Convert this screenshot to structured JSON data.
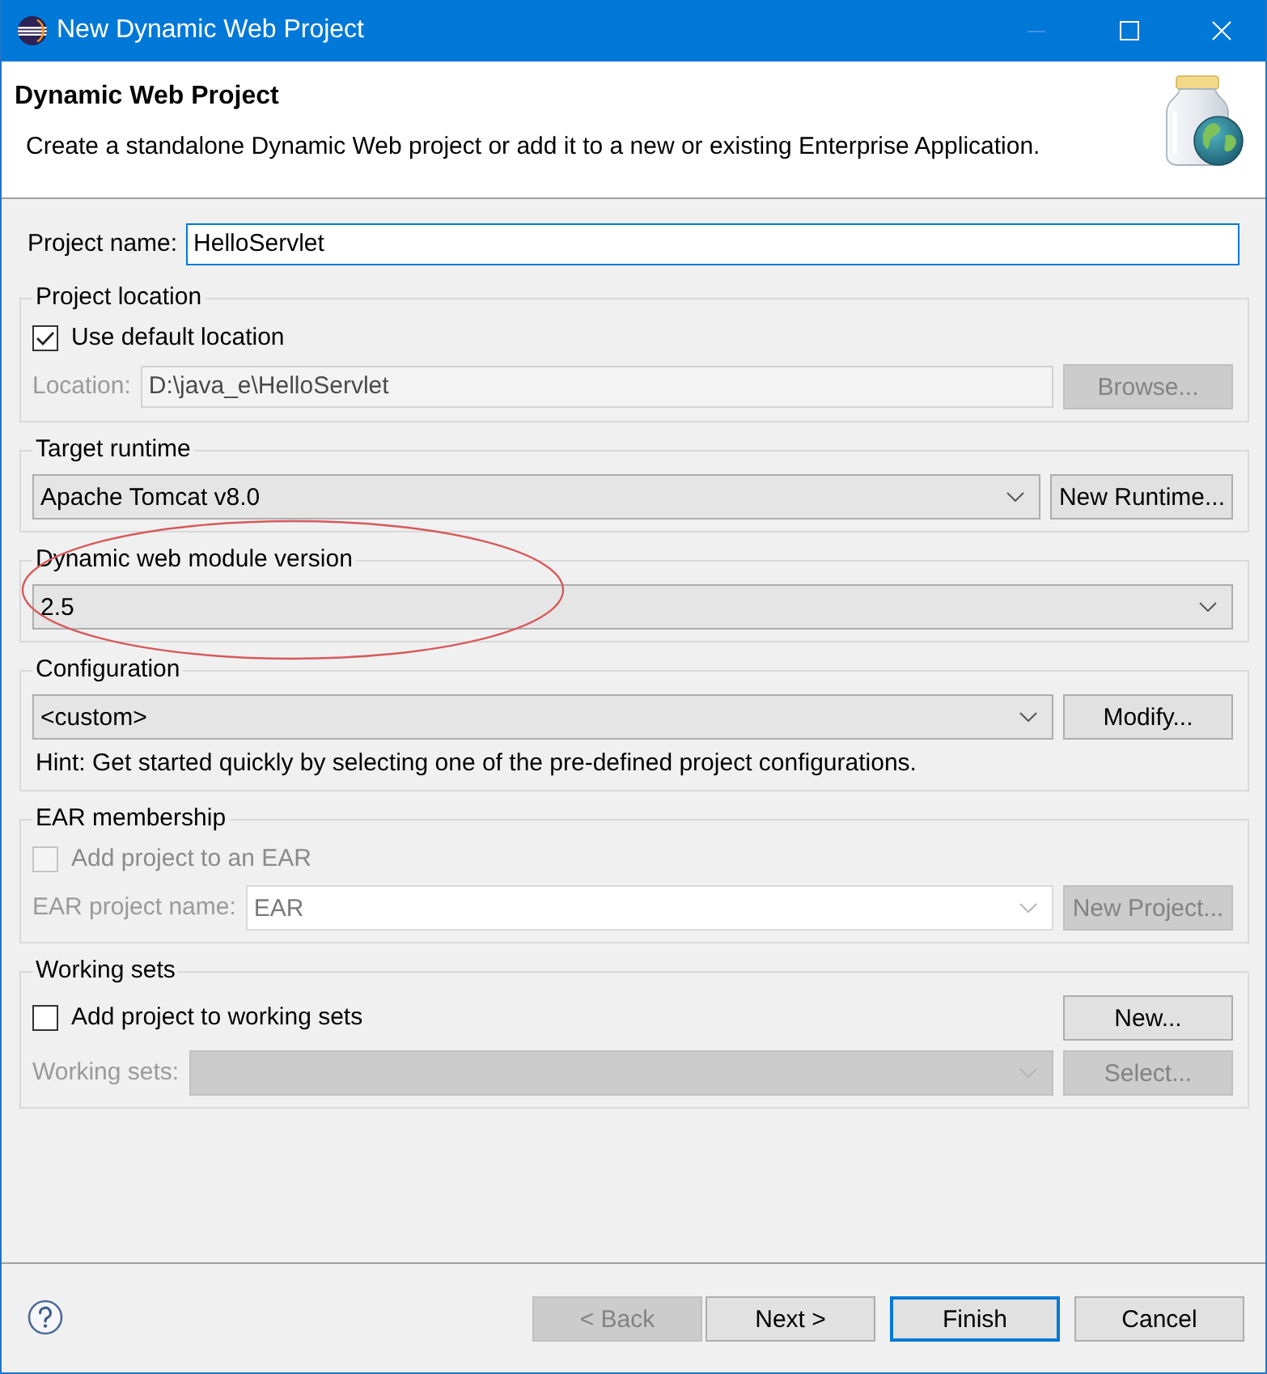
{
  "window": {
    "title": "New Dynamic Web Project"
  },
  "window_controls": [
    {
      "kind": "minimize",
      "disabled": true
    },
    {
      "kind": "maximize",
      "disabled": false
    },
    {
      "kind": "close",
      "disabled": false
    }
  ],
  "header": {
    "title": "Dynamic Web Project",
    "description": "Create a standalone Dynamic Web project or add it to a new or existing Enterprise Application."
  },
  "project_name": {
    "label": "Project name:",
    "value": "HelloServlet",
    "focused": true
  },
  "groups": [
    {
      "title": "Project location",
      "circled": false,
      "rows": [
        [
          {
            "kind": "checkbox",
            "label": "Use default location",
            "checked": true,
            "disabled": false
          }
        ],
        [
          {
            "kind": "label",
            "text": "Location:",
            "disabled": true
          },
          {
            "kind": "field",
            "value": "D:\\java_e\\HelloServlet",
            "disabled": true
          },
          {
            "kind": "button",
            "label": "Browse...",
            "disabled": true
          }
        ]
      ]
    },
    {
      "title": "Target runtime",
      "circled": false,
      "rows": [
        [
          {
            "kind": "combo",
            "value": "Apache Tomcat v8.0",
            "editable": false,
            "disabled": false
          },
          {
            "kind": "button",
            "label": "New Runtime...",
            "disabled": false
          }
        ]
      ]
    },
    {
      "title": "Dynamic web module version",
      "circled": true,
      "rows": [
        [
          {
            "kind": "combo",
            "value": "2.5",
            "editable": false,
            "disabled": false
          }
        ]
      ]
    },
    {
      "title": "Configuration",
      "circled": false,
      "rows": [
        [
          {
            "kind": "combo",
            "value": "<custom>",
            "editable": false,
            "disabled": false
          },
          {
            "kind": "button",
            "label": "Modify...",
            "disabled": false
          }
        ],
        [
          {
            "kind": "hint",
            "text": "Hint: Get started quickly by selecting one of the pre-defined project configurations."
          }
        ]
      ]
    },
    {
      "title": "EAR membership",
      "circled": false,
      "rows": [
        [
          {
            "kind": "checkbox",
            "label": "Add project to an EAR",
            "checked": false,
            "disabled": true
          }
        ],
        [
          {
            "kind": "label",
            "text": "EAR project name:",
            "disabled": true
          },
          {
            "kind": "combo",
            "value": "EAR",
            "editable": true,
            "disabled": true
          },
          {
            "kind": "button",
            "label": "New Project...",
            "disabled": true
          }
        ]
      ]
    },
    {
      "title": "Working sets",
      "circled": false,
      "rows": [
        [
          {
            "kind": "checkbox",
            "label": "Add project to working sets",
            "checked": false,
            "disabled": false
          },
          {
            "kind": "button",
            "label": "New...",
            "disabled": false
          }
        ],
        [
          {
            "kind": "label",
            "text": "Working sets:",
            "disabled": true
          },
          {
            "kind": "combo",
            "editable": false,
            "disabled": true
          },
          {
            "kind": "button",
            "label": "Select...",
            "disabled": true
          }
        ]
      ]
    }
  ],
  "footer": {
    "buttons": [
      {
        "label": "< Back",
        "disabled": true,
        "default": false
      },
      {
        "label": "Next >",
        "disabled": false,
        "default": false
      },
      {
        "label": "Finish",
        "disabled": false,
        "default": true
      },
      {
        "label": "Cancel",
        "disabled": false,
        "default": false
      }
    ]
  }
}
